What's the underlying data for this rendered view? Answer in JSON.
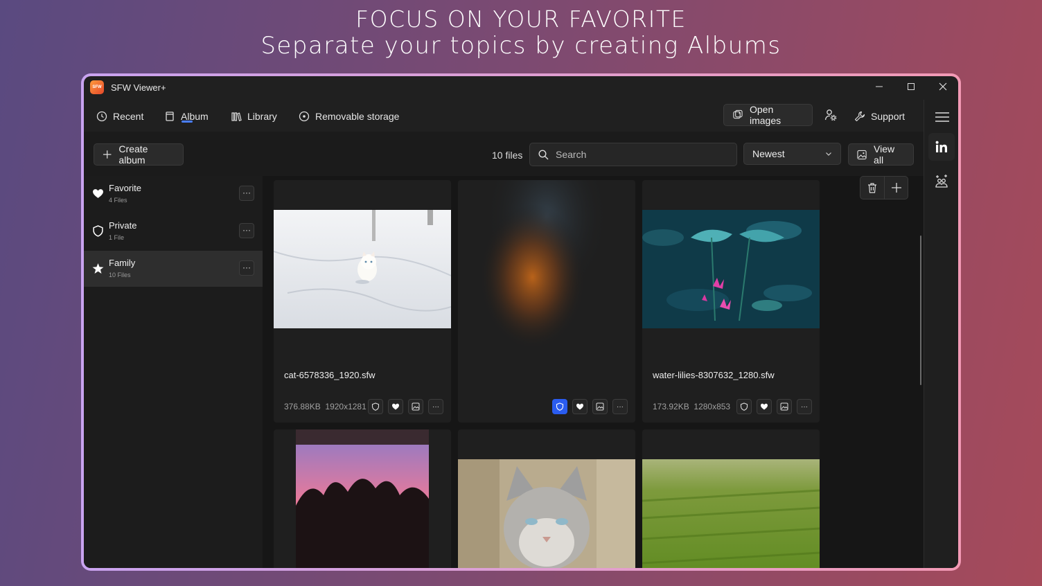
{
  "promo": {
    "line1": "FOCUS ON YOUR FAVORITE",
    "line2": "Separate your topics by creating Albums"
  },
  "app": {
    "logo_text": "SFW",
    "title": "SFW Viewer+"
  },
  "nav": {
    "recent": "Recent",
    "album": "Album",
    "library": "Library",
    "removable": "Removable storage",
    "open_images": "Open images",
    "support": "Support"
  },
  "toolbar": {
    "create_album": "Create album",
    "file_count": "10 files",
    "search_placeholder": "Search",
    "sort_selected": "Newest",
    "view_all": "View all"
  },
  "albums": [
    {
      "name": "Favorite",
      "count": "4 Files",
      "icon": "heart-icon"
    },
    {
      "name": "Private",
      "count": "1 File",
      "icon": "shield-icon"
    },
    {
      "name": "Family",
      "count": "10 Files",
      "icon": "star-icon",
      "selected": true
    }
  ],
  "more_label": "···",
  "images": [
    {
      "file": "cat-6578336_1920.sfw",
      "size": "376.88KB",
      "dims": "1920x1281"
    },
    {
      "file": "",
      "size": "",
      "dims": "",
      "private": true
    },
    {
      "file": "water-lilies-8307632_1280.sfw",
      "size": "173.92KB",
      "dims": "1280x853"
    }
  ],
  "colors": {
    "accent": "#2a5cf0",
    "window_bg": "#202020"
  }
}
